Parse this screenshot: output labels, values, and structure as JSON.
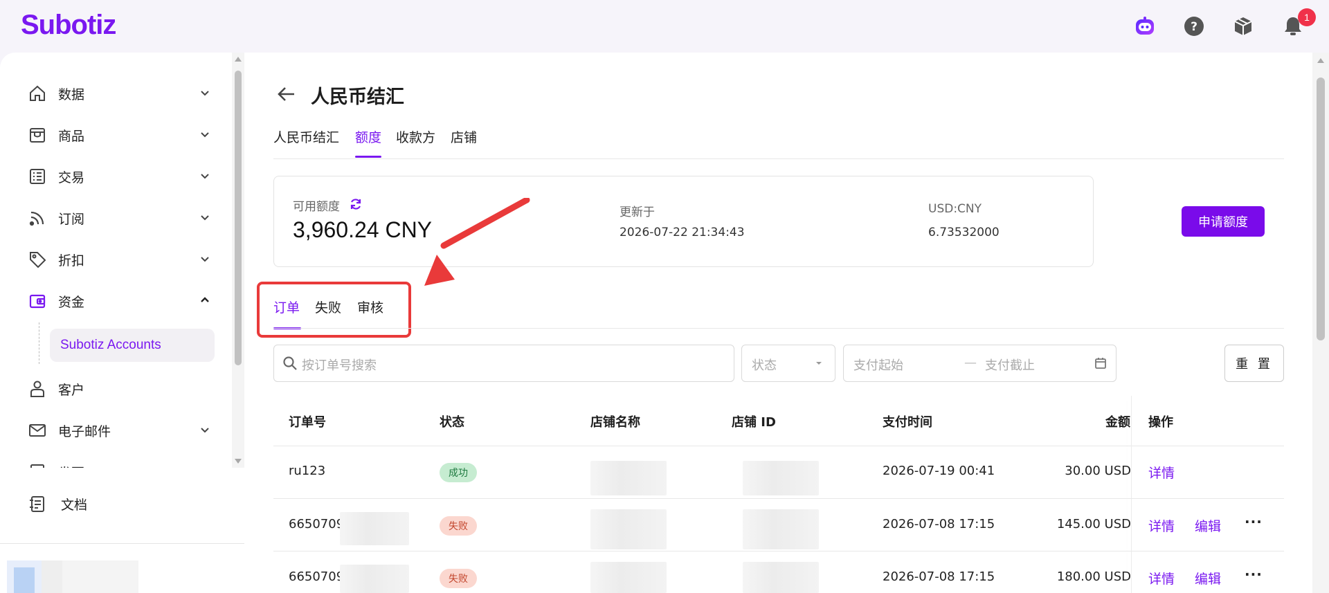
{
  "brand": {
    "name": "Subotiz",
    "accent": "#7a18f0"
  },
  "topbar": {
    "icons": [
      "assistant-bot-icon",
      "help-icon",
      "package-icon",
      "bell-icon"
    ],
    "notification_count": "1"
  },
  "sidebar": {
    "items": [
      {
        "label": "数据",
        "icon": "home-icon",
        "expanded": false
      },
      {
        "label": "商品",
        "icon": "store-icon",
        "expanded": false
      },
      {
        "label": "交易",
        "icon": "list-icon",
        "expanded": false
      },
      {
        "label": "订阅",
        "icon": "rss-icon",
        "expanded": false
      },
      {
        "label": "折扣",
        "icon": "tag-icon",
        "expanded": false
      },
      {
        "label": "资金",
        "icon": "wallet-icon",
        "expanded": true
      },
      {
        "label": "客户",
        "icon": "user-icon"
      },
      {
        "label": "电子邮件",
        "icon": "mail-icon",
        "expanded": false
      },
      {
        "label": "发票",
        "icon": "invoice-icon",
        "expanded": false
      }
    ],
    "sub_item": "Subotiz Accounts",
    "docs_label": "文档"
  },
  "page": {
    "title": "人民币结汇",
    "tabs": [
      "人民币结汇",
      "额度",
      "收款方",
      "店铺"
    ],
    "active_tab": 1
  },
  "quota_card": {
    "available_label": "可用额度",
    "available_value": "3,960.24 CNY",
    "updated_label": "更新于",
    "updated_value": "2026-07-22 21:34:43",
    "rate_label": "USD:CNY",
    "rate_value": "6.73532000",
    "apply_button": "申请额度"
  },
  "sub_tabs": {
    "items": [
      "订单",
      "失败",
      "审核"
    ],
    "active": 0
  },
  "filters": {
    "search_placeholder": "按订单号搜索",
    "status_placeholder": "状态",
    "date_start_placeholder": "支付起始",
    "date_separator": "—",
    "date_end_placeholder": "支付截止",
    "reset_button": "重 置"
  },
  "table": {
    "columns": [
      "订单号",
      "状态",
      "店铺名称",
      "店铺 ID",
      "支付时间",
      "金额",
      "操作"
    ],
    "rows": [
      {
        "order_no": "ru123",
        "status": "成功",
        "status_type": "ok",
        "paid_at": "2026-07-19 00:41",
        "amount": "30.00 USD",
        "actions": [
          "详情"
        ]
      },
      {
        "order_no": "66507090",
        "status": "失败",
        "status_type": "fail",
        "paid_at": "2026-07-08 17:15",
        "amount": "145.00 USD",
        "actions": [
          "详情",
          "编辑",
          "···"
        ]
      },
      {
        "order_no": "66507090",
        "status": "失败",
        "status_type": "fail",
        "paid_at": "2026-07-08 17:15",
        "amount": "180.00 USD",
        "actions": [
          "详情",
          "编辑",
          "···"
        ]
      }
    ]
  },
  "annotation": {
    "color": "#e93a3a"
  }
}
